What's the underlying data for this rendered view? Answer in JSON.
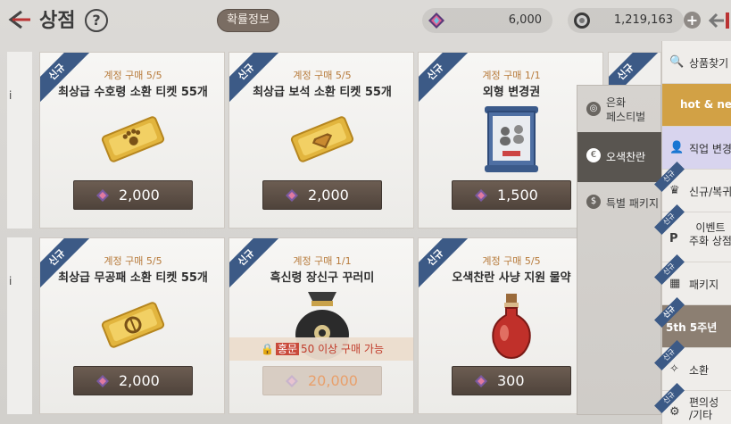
{
  "header": {
    "title": "상점",
    "help_icon": "question-circle-icon",
    "probability_button": "확률정보",
    "currencies": [
      {
        "icon": "colorful-gem-icon",
        "value": "6,000"
      },
      {
        "icon": "silver-coin-icon",
        "value": "1,219,163"
      }
    ]
  },
  "left_partial_labels": [
    "i",
    "i"
  ],
  "products": [
    {
      "badge": "신규",
      "limit": "계정 구매 5/5",
      "name": "최상급 수호령 소환 티켓 55개",
      "price": "2,000",
      "icon": "gold-paw-ticket-icon"
    },
    {
      "badge": "신규",
      "limit": "계정 구매 5/5",
      "name": "최상급 보석 소환 티켓 55개",
      "price": "2,000",
      "icon": "gold-jewel-ticket-icon"
    },
    {
      "badge": "신규",
      "limit": "계정 구매 1/1",
      "name": "외형 변경권",
      "price": "1,500",
      "icon": "appearance-scroll-icon"
    },
    {
      "badge": "신규",
      "limit": "계정 구매 5/5",
      "name": "최상급 무공패 소환 티켓 55개",
      "price": "2,000",
      "icon": "gold-plaque-ticket-icon"
    },
    {
      "badge": "신규",
      "limit": "계정 구매 1/1",
      "name": "흑신령 장신구 꾸러미",
      "price": "20,000",
      "icon": "black-pouch-icon",
      "lock": {
        "tag": "홍문",
        "text": "50 이상 구매 가능"
      }
    },
    {
      "badge": "신규",
      "limit": "계정 구매 5/5",
      "name": "오색찬란 사냥 지원 물약",
      "price": "300",
      "icon": "red-potion-icon"
    }
  ],
  "partial_card_badge": "신규",
  "submenu": [
    {
      "label": "은화\n페스티벌",
      "icon": "coin-icon",
      "active": false
    },
    {
      "label": "오색찬란",
      "icon": "gem-bag-icon",
      "active": true
    },
    {
      "label": "특별 패키지",
      "icon": "package-coin-icon",
      "active": false
    }
  ],
  "sidebar": [
    {
      "label": "상품찾기",
      "icon": "search-icon",
      "style": "normal"
    },
    {
      "label": "hot & new",
      "icon": "",
      "style": "hot"
    },
    {
      "label": "직업 변경",
      "icon": "person-icon",
      "style": "job"
    },
    {
      "label": "신규/복귀",
      "icon": "crown-icon",
      "style": "normal",
      "badge": "신규"
    },
    {
      "label": "이벤트\n주화 상점",
      "icon": "p-coin-icon",
      "style": "normal",
      "badge": "신규"
    },
    {
      "label": "패키지",
      "icon": "package-icon",
      "style": "normal",
      "badge": "신규"
    },
    {
      "label": "5th 5주년",
      "icon": "",
      "style": "anniv",
      "badge": "신규"
    },
    {
      "label": "소환",
      "icon": "summon-icon",
      "style": "normal",
      "badge": "신규"
    },
    {
      "label": "편의성\n/기타",
      "icon": "gear-icon",
      "style": "normal",
      "badge": "신규"
    }
  ]
}
